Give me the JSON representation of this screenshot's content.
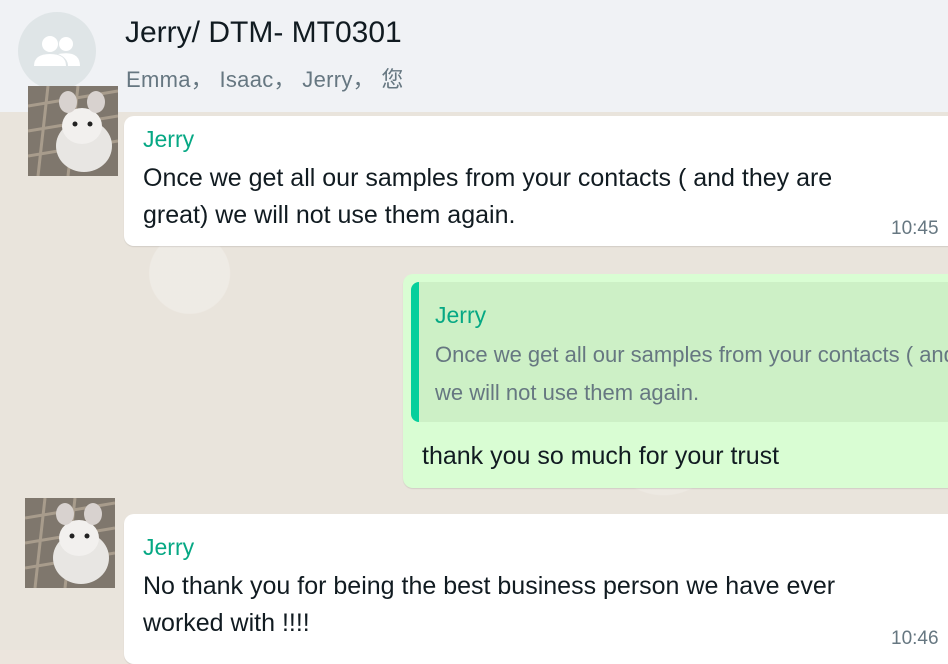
{
  "header": {
    "title": "Jerry/ DTM- MT0301",
    "members": "Emma， Isaac， Jerry， 您"
  },
  "messages": [
    {
      "sender": "Jerry",
      "line1": "Once we get all our samples from your contacts ( and they are",
      "line2": "great) we will not use them again.",
      "time": "10:45"
    },
    {
      "quote_sender": "Jerry",
      "quote_line1": "Once we get all our samples from your contacts ( and they are great)",
      "quote_line2": "we will not use them again.",
      "text": "thank you so much for your trust"
    },
    {
      "sender": "Jerry",
      "line1": "No thank you for being the best business person we have ever",
      "line2": "worked with !!!!",
      "time": "10:46"
    }
  ],
  "colors": {
    "sender_name": "#06a884",
    "outgoing_bubble": "#d9fdd3",
    "quote_bar": "#06cf9c"
  }
}
